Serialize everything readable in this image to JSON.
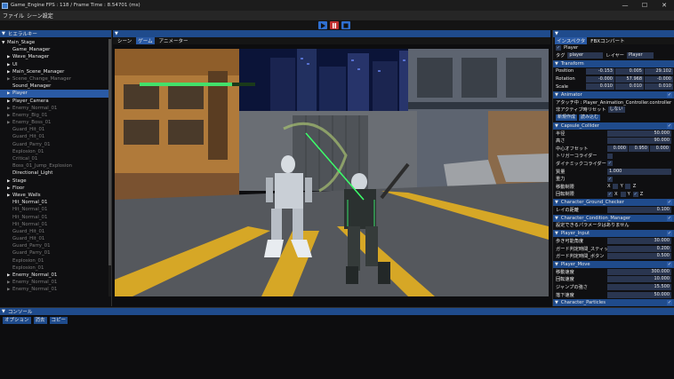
{
  "window": {
    "title": "Game_Engine   FPS : 118 / Frame Time : 8.54701 (ms)",
    "minimize": "—",
    "maximize": "☐",
    "close": "✕"
  },
  "menu": [
    "ファイル",
    "シーン設定"
  ],
  "playbar": {
    "play_icon": "play-icon",
    "pause_icon": "pause-icon",
    "stop_icon": "stop-icon",
    "play_color": "#2f6fd0",
    "pause_color": "#c03030",
    "stop_color": "#2f6fd0"
  },
  "hierarchy": {
    "title": "ヒエラルキー",
    "items": [
      {
        "label": "Main_Stage",
        "indent": 0,
        "arrow": "▼",
        "dim": false
      },
      {
        "label": "Game_Manager",
        "indent": 1,
        "arrow": "",
        "dim": false
      },
      {
        "label": "Wave_Manager",
        "indent": 1,
        "arrow": "▶",
        "dim": false
      },
      {
        "label": "UI",
        "indent": 1,
        "arrow": "▶",
        "dim": false
      },
      {
        "label": "Main_Scene_Manager",
        "indent": 1,
        "arrow": "▶",
        "dim": false
      },
      {
        "label": "Scene_Change_Manager",
        "indent": 1,
        "arrow": "▶",
        "dim": true
      },
      {
        "label": "Sound_Manager",
        "indent": 1,
        "arrow": "",
        "dim": false
      },
      {
        "label": "Player",
        "indent": 1,
        "arrow": "▶",
        "dim": false,
        "selected": true
      },
      {
        "label": "Player_Camera",
        "indent": 1,
        "arrow": "▶",
        "dim": false
      },
      {
        "label": "Enemy_Normal_01",
        "indent": 1,
        "arrow": "▶",
        "dim": true
      },
      {
        "label": "Enemy_Big_01",
        "indent": 1,
        "arrow": "▶",
        "dim": true
      },
      {
        "label": "Enemy_Boss_01",
        "indent": 1,
        "arrow": "▶",
        "dim": true
      },
      {
        "label": "Guard_Hit_01",
        "indent": 1,
        "arrow": "",
        "dim": true
      },
      {
        "label": "Guard_Hit_01",
        "indent": 1,
        "arrow": "",
        "dim": true
      },
      {
        "label": "Guard_Parry_01",
        "indent": 1,
        "arrow": "",
        "dim": true
      },
      {
        "label": "Explosion_01",
        "indent": 1,
        "arrow": "",
        "dim": true
      },
      {
        "label": "Critical_01",
        "indent": 1,
        "arrow": "",
        "dim": true
      },
      {
        "label": "Boss_01_Jump_Explosion",
        "indent": 1,
        "arrow": "",
        "dim": true
      },
      {
        "label": "Directional_Light",
        "indent": 1,
        "arrow": "",
        "dim": false
      },
      {
        "label": "Stage",
        "indent": 1,
        "arrow": "▶",
        "dim": false
      },
      {
        "label": "Floor",
        "indent": 1,
        "arrow": "▶",
        "dim": false
      },
      {
        "label": "Wave_Walls",
        "indent": 1,
        "arrow": "▶",
        "dim": false
      },
      {
        "label": "Hit_Normal_01",
        "indent": 1,
        "arrow": "",
        "dim": false
      },
      {
        "label": "Hit_Normal_01",
        "indent": 1,
        "arrow": "",
        "dim": true
      },
      {
        "label": "Hit_Normal_01",
        "indent": 1,
        "arrow": "",
        "dim": true
      },
      {
        "label": "Hit_Normal_01",
        "indent": 1,
        "arrow": "",
        "dim": true
      },
      {
        "label": "Guard_Hit_01",
        "indent": 1,
        "arrow": "",
        "dim": true
      },
      {
        "label": "Guard_Hit_01",
        "indent": 1,
        "arrow": "",
        "dim": true
      },
      {
        "label": "Guard_Parry_01",
        "indent": 1,
        "arrow": "",
        "dim": true
      },
      {
        "label": "Guard_Parry_01",
        "indent": 1,
        "arrow": "",
        "dim": true
      },
      {
        "label": "Explosion_01",
        "indent": 1,
        "arrow": "",
        "dim": true
      },
      {
        "label": "Explosion_01",
        "indent": 1,
        "arrow": "",
        "dim": true
      },
      {
        "label": "Enemy_Normal_01",
        "indent": 1,
        "arrow": "▶",
        "dim": false
      },
      {
        "label": "Enemy_Normal_01",
        "indent": 1,
        "arrow": "▶",
        "dim": true
      },
      {
        "label": "Enemy_Normal_01",
        "indent": 1,
        "arrow": "▶",
        "dim": true
      }
    ]
  },
  "scene": {
    "tabs": [
      "シーン",
      "ゲーム",
      "アニメーター"
    ],
    "active_tab": "ゲーム",
    "player_hp_fraction": 0.8
  },
  "inspector": {
    "tabs": [
      "インスペクタ",
      "FBXコンバート"
    ],
    "object_name": "Player",
    "tag_label": "タグ",
    "tag_value": "player",
    "layer_label": "レイヤー",
    "layer_value": "Player",
    "transform": {
      "title": "Transform",
      "position_label": "Position",
      "position": [
        "-0.153",
        "0.005",
        "29.102"
      ],
      "rotation_label": "Rotation",
      "rotation": [
        "-0.000",
        "57.968",
        "-0.000"
      ],
      "scale_label": "Scale",
      "scale": [
        "0.010",
        "0.010",
        "0.010"
      ]
    },
    "animator": {
      "title": "Animator",
      "attach_label": "アタッチ中 : Player_Animation_Controller.controller",
      "reset_label": "非アクティブ時リセット",
      "reset_value": "しない",
      "buttons": [
        "新規作成",
        "読み込む"
      ]
    },
    "capsule": {
      "title": "Capsule_Collider",
      "rows": [
        {
          "label": "半径",
          "value": "50.000"
        },
        {
          "label": "高さ",
          "value": "90.000"
        }
      ],
      "center_label": "中心オフセット",
      "center": [
        "0.000",
        "0.950",
        "0.000"
      ],
      "trigger_label": "トリガーコライダー",
      "dynamic_label": "ダイナミックコライダー",
      "mass_label": "質量",
      "mass_value": "1.000",
      "gravity_label": "重力",
      "move_limit_label": "移動制限",
      "rot_limit_label": "回転制限",
      "axes": [
        "X",
        "Y",
        "Z"
      ]
    },
    "ground_checker": {
      "title": "Character_Ground_Checker",
      "ray_label": "レイの距離",
      "ray_value": "0.100"
    },
    "condition_manager": {
      "title": "Character_Condition_Manager",
      "note": "設定できるパラメータはありません"
    },
    "player_input": {
      "title": "Player_Input",
      "rows": [
        {
          "label": "歩き可能角度",
          "value": "30.000"
        },
        {
          "label": "ガード判定時間_スティック",
          "value": "0.200"
        },
        {
          "label": "ガード判定時間_ボタン",
          "value": "0.500"
        }
      ]
    },
    "player_move": {
      "title": "Player_Move",
      "rows": [
        {
          "label": "移動速度",
          "value": "300.000"
        },
        {
          "label": "回転速度",
          "value": "10.000"
        },
        {
          "label": "ジャンプの強さ",
          "value": "15.500"
        },
        {
          "label": "落下速度",
          "value": "50.000"
        }
      ]
    },
    "particles": {
      "title": "Character_Particles"
    }
  },
  "console": {
    "title": "コンソール",
    "tools": [
      "オプション",
      "消去",
      "コピー"
    ]
  }
}
